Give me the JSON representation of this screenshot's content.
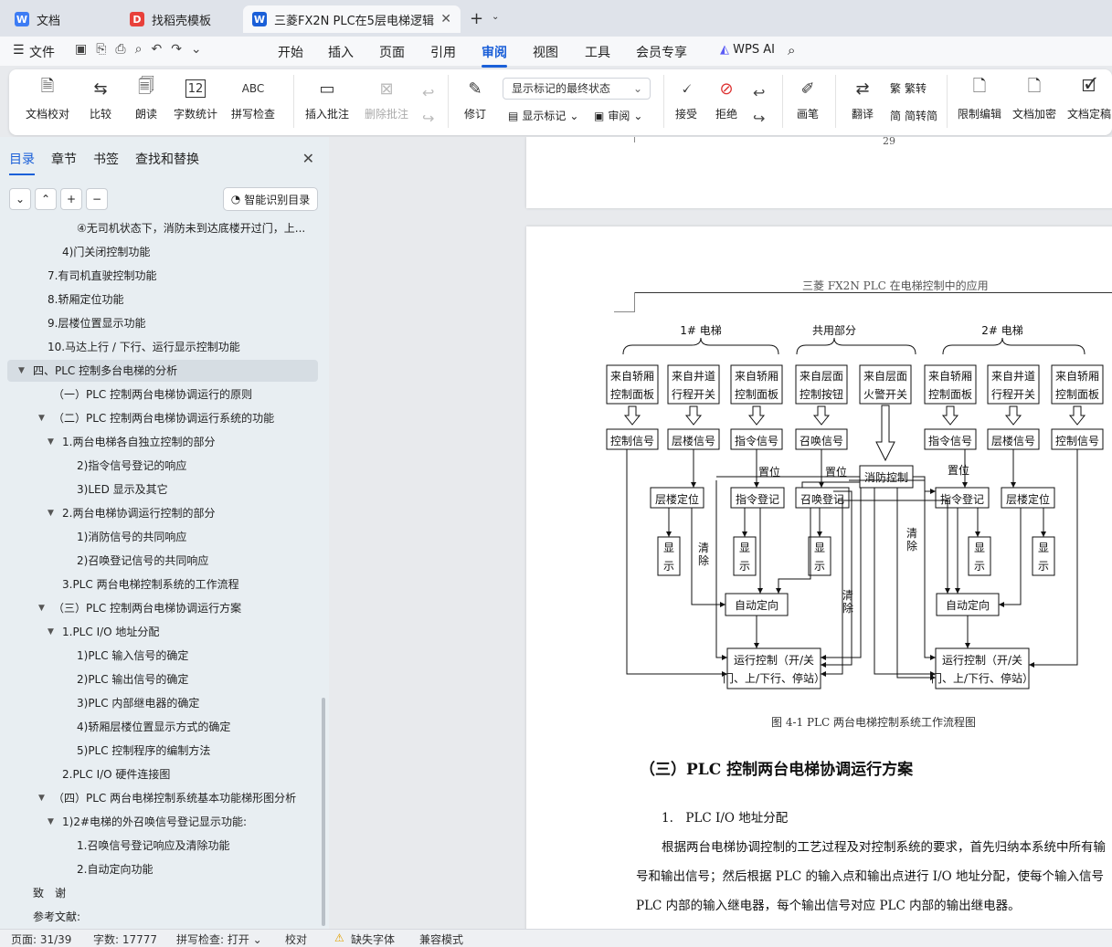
{
  "tabs": [
    {
      "label": "文档",
      "icon": "W",
      "color": "#3d7cf4"
    },
    {
      "label": "找稻壳模板",
      "icon": "D",
      "color": "#e8403a"
    },
    {
      "label": "三菱FX2N PLC在5层电梯逻辑",
      "icon": "W",
      "color": "#1a5fd8"
    }
  ],
  "menu": {
    "file": "文件",
    "items": [
      "开始",
      "插入",
      "页面",
      "引用",
      "审阅",
      "视图",
      "工具",
      "会员专享"
    ],
    "active": "审阅",
    "ai": "WPS AI"
  },
  "ribbon": {
    "buttons": [
      "文档校对",
      "比较",
      "朗读",
      "字数统计",
      "拼写检查",
      "插入批注",
      "删除批注",
      "修订",
      "接受",
      "拒绝",
      "画笔",
      "翻译",
      "限制编辑",
      "文档加密",
      "文档定稿"
    ],
    "dropdown": "显示标记的最终状态",
    "show_markup": "显示标记",
    "review": "审阅",
    "fanjian": "繁转",
    "jianfan": "简转简"
  },
  "sidebar": {
    "tabs": [
      "目录",
      "章节",
      "书签",
      "查找和替换"
    ],
    "smart": "智能识别目录",
    "toc": [
      {
        "t": "④无司机状态下，消防未到达底楼开过门，上...",
        "x": 84,
        "tri": ""
      },
      {
        "t": "4)门关闭控制功能",
        "x": 68,
        "tri": ""
      },
      {
        "t": "7.有司机直驶控制功能",
        "x": 52,
        "tri": ""
      },
      {
        "t": "8.轿厢定位功能",
        "x": 52,
        "tri": ""
      },
      {
        "t": "9.层楼位置显示功能",
        "x": 52,
        "tri": ""
      },
      {
        "t": "10.马达上行 / 下行、运行显示控制功能",
        "x": 52,
        "tri": ""
      },
      {
        "t": "四、PLC 控制多台电梯的分析",
        "x": 36,
        "tri": "▼",
        "sel": true
      },
      {
        "t": "（一）PLC 控制两台电梯协调运行的原则",
        "x": 58,
        "tri": ""
      },
      {
        "t": "（二）PLC 控制两台电梯协调运行系统的功能",
        "x": 58,
        "tri": "▼"
      },
      {
        "t": "1.两台电梯各自独立控制的部分",
        "x": 68,
        "tri": "▼"
      },
      {
        "t": "2)指令信号登记的响应",
        "x": 84,
        "tri": ""
      },
      {
        "t": "3)LED 显示及其它",
        "x": 84,
        "tri": ""
      },
      {
        "t": "2.两台电梯协调运行控制的部分",
        "x": 68,
        "tri": "▼"
      },
      {
        "t": "1)消防信号的共同响应",
        "x": 84,
        "tri": ""
      },
      {
        "t": "2)召唤登记信号的共同响应",
        "x": 84,
        "tri": ""
      },
      {
        "t": "3.PLC 两台电梯控制系统的工作流程",
        "x": 68,
        "tri": ""
      },
      {
        "t": "（三）PLC 控制两台电梯协调运行方案",
        "x": 58,
        "tri": "▼"
      },
      {
        "t": "1.PLC I/O 地址分配",
        "x": 68,
        "tri": "▼"
      },
      {
        "t": "1)PLC 输入信号的确定",
        "x": 84,
        "tri": ""
      },
      {
        "t": "2)PLC 输出信号的确定",
        "x": 84,
        "tri": ""
      },
      {
        "t": "3)PLC 内部继电器的确定",
        "x": 84,
        "tri": ""
      },
      {
        "t": "4)轿厢层楼位置显示方式的确定",
        "x": 84,
        "tri": ""
      },
      {
        "t": "5)PLC 控制程序的编制方法",
        "x": 84,
        "tri": ""
      },
      {
        "t": "2.PLC I/O 硬件连接图",
        "x": 68,
        "tri": ""
      },
      {
        "t": "（四）PLC 两台电梯控制系统基本功能梯形图分析",
        "x": 58,
        "tri": "▼"
      },
      {
        "t": "1)2#电梯的外召唤信号登记显示功能:",
        "x": 68,
        "tri": "▼"
      },
      {
        "t": "1.召唤信号登记响应及清除功能",
        "x": 84,
        "tri": ""
      },
      {
        "t": "2.自动定向功能",
        "x": 84,
        "tri": ""
      },
      {
        "t": "致　谢",
        "x": 36,
        "tri": ""
      },
      {
        "t": "参考文献:",
        "x": 36,
        "tri": ""
      }
    ]
  },
  "document": {
    "page_number": "29",
    "header": "三菱 FX2N PLC 在电梯控制中的应用",
    "diagram": {
      "groups": [
        "1# 电梯",
        "共用部分",
        "2# 电梯"
      ],
      "sources": [
        "来自轿厢控制面板",
        "来自井道行程开关",
        "来自轿厢控制面板",
        "来自层面控制按钮",
        "来自层面火警开关",
        "来自轿厢控制面板",
        "来自井道行程开关",
        "来自轿厢控制面板"
      ],
      "signals": [
        "控制信号",
        "层楼信号",
        "指令信号",
        "召唤信号",
        "指令信号",
        "层楼信号",
        "控制信号"
      ],
      "fire": "消防控制",
      "reg": [
        "层楼定位",
        "指令登记",
        "召唤登记",
        "指令登记",
        "层楼定位"
      ],
      "display": "显示",
      "set": "置位",
      "clear": "清除",
      "auto": "自动定向",
      "run1": "运行控制（开/关",
      "run2": "门、上/下行、停站）",
      "caption": "图 4-1   PLC 两台电梯控制系统工作流程图"
    },
    "heading": "（三）PLC 控制两台电梯协调运行方案",
    "sub": "1.　PLC I/O 地址分配",
    "para": [
      "根据两台电梯协调控制的工艺过程及对控制系统的要求，首先归纳本系统中所有输",
      "号和输出信号；然后根据 PLC 的输入点和输出点进行 I/O 地址分配，使每个输入信号",
      "PLC 内部的输入继电器，每个输出信号对应 PLC 内部的输出继电器。"
    ]
  },
  "status": {
    "page": "页面: 31/39",
    "words": "字数: 17777",
    "spell": "拼写检查: 打开",
    "proof": "校对",
    "font": "缺失字体",
    "compat": "兼容模式"
  }
}
